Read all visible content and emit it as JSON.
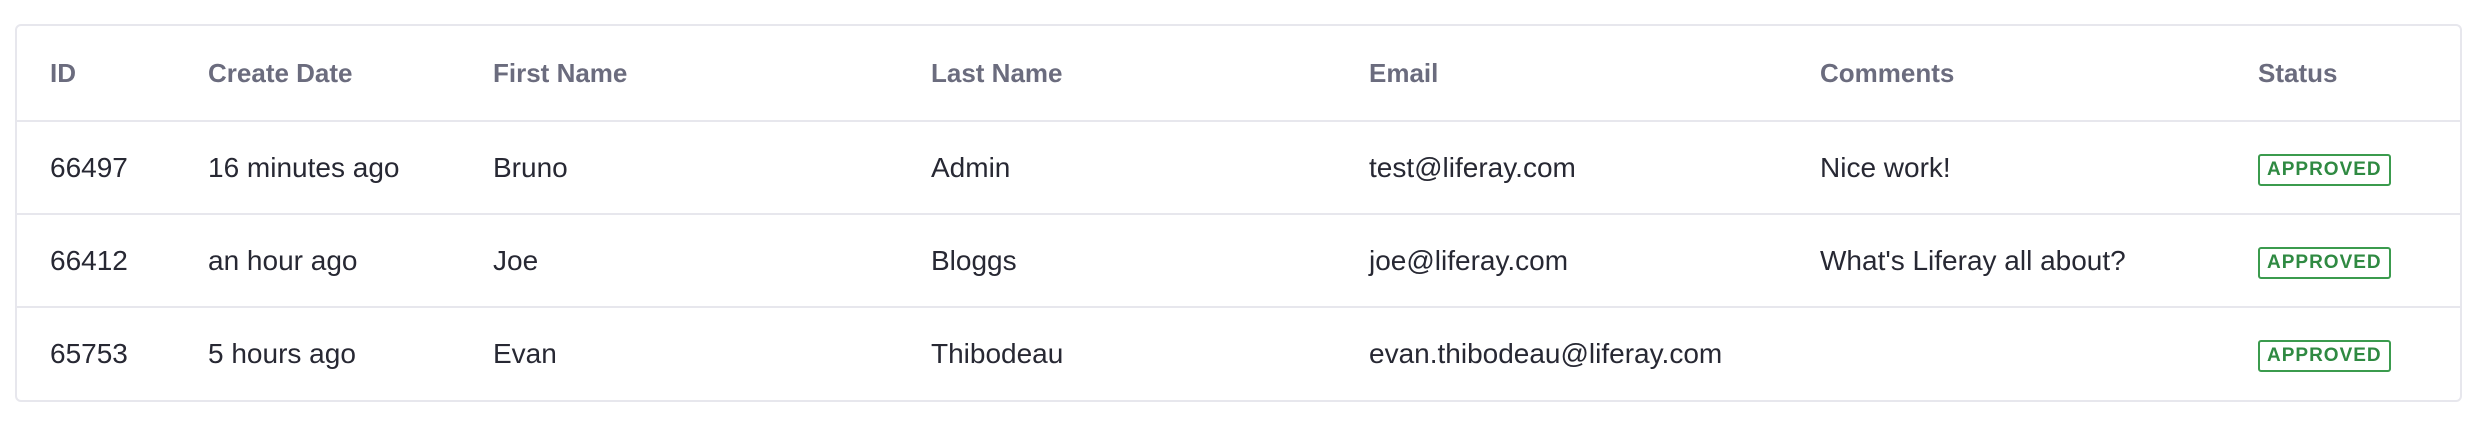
{
  "table": {
    "columns": [
      "ID",
      "Create Date",
      "First Name",
      "Last Name",
      "Email",
      "Comments",
      "Status"
    ],
    "rows": [
      {
        "id": "66497",
        "create_date": "16 minutes ago",
        "first_name": "Bruno",
        "last_name": "Admin",
        "email": "test@liferay.com",
        "comments": "Nice work!",
        "status": "APPROVED"
      },
      {
        "id": "66412",
        "create_date": "an hour ago",
        "first_name": "Joe",
        "last_name": "Bloggs",
        "email": "joe@liferay.com",
        "comments": "What's Liferay all about?",
        "status": "APPROVED"
      },
      {
        "id": "65753",
        "create_date": "5 hours ago",
        "first_name": "Evan",
        "last_name": "Thibodeau",
        "email": "evan.thibodeau@liferay.com",
        "comments": "",
        "status": "APPROVED"
      }
    ]
  },
  "colors": {
    "header_text": "#6b6c7e",
    "cell_text": "#272833",
    "border": "#e7e7ed",
    "status_approved": "#2f8a42"
  }
}
